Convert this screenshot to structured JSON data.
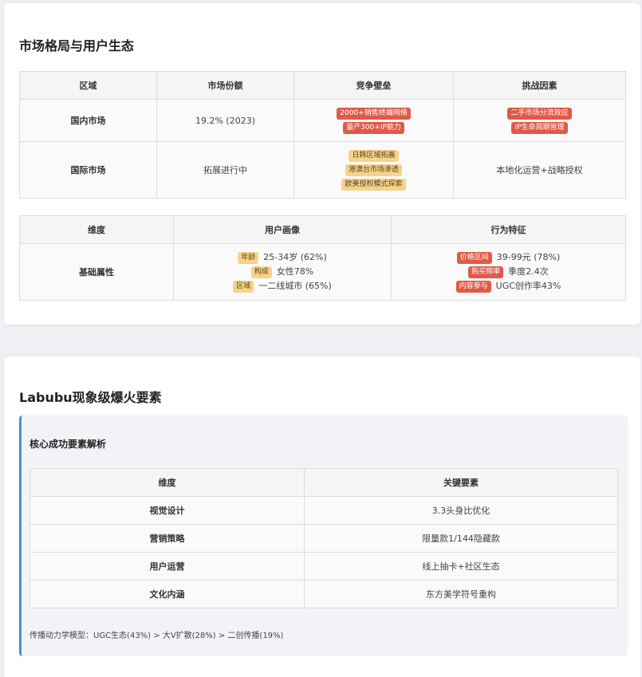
{
  "market": {
    "title": "市场格局与用户生态",
    "headers": [
      "区域",
      "市场份额",
      "竞争壁垒",
      "挑战因素"
    ],
    "rows": [
      {
        "region": "国内市场",
        "share": "19.2% (2023)",
        "barriers": [
          "2000+销售终端网络",
          "量产300+IP能力"
        ],
        "challenges_tags": [
          "二手市场分流效应",
          "IP生命周期管理"
        ]
      },
      {
        "region": "国际市场",
        "share": "拓展进行中",
        "barriers": [
          "日韩区域拓展",
          "港澳台市场渗透",
          "欧美授权模式探索"
        ],
        "challenge_text": "本地化运营+战略授权"
      }
    ]
  },
  "users": {
    "headers": [
      "维度",
      "用户画像",
      "行为特征"
    ],
    "row_label": "基础属性",
    "profile": [
      {
        "tag": "年龄",
        "value": "25-34岁 (62%)"
      },
      {
        "tag": "构成",
        "value": "女性78%"
      },
      {
        "tag": "区域",
        "value": "一二线城市 (65%)"
      }
    ],
    "behavior": [
      {
        "tag": "价格区间",
        "value": "39-99元 (78%)"
      },
      {
        "tag": "购买频率",
        "value": "季度2.4次"
      },
      {
        "tag": "内容参与",
        "value": "UGC创作率43%"
      }
    ]
  },
  "factors": {
    "title": "Labubu现象级爆火要素",
    "panel_title": "核心成功要素解析",
    "headers": [
      "维度",
      "关键要素"
    ],
    "rows": [
      {
        "dim": "视觉设计",
        "key": "3.3头身比优化"
      },
      {
        "dim": "营销策略",
        "key": "限量款1/144隐藏款"
      },
      {
        "dim": "用户运营",
        "key": "线上抽卡+社区生态"
      },
      {
        "dim": "文化内涵",
        "key": "东方美学符号重构"
      }
    ],
    "footnote": "传播动力学模型：UGC生态(43%) > 大V扩散(28%) > 二创传播(19%)"
  },
  "colors": {
    "accent": "#4a90d9",
    "tag_red": "#e05a47",
    "tag_yellow": "#f6d28b"
  }
}
